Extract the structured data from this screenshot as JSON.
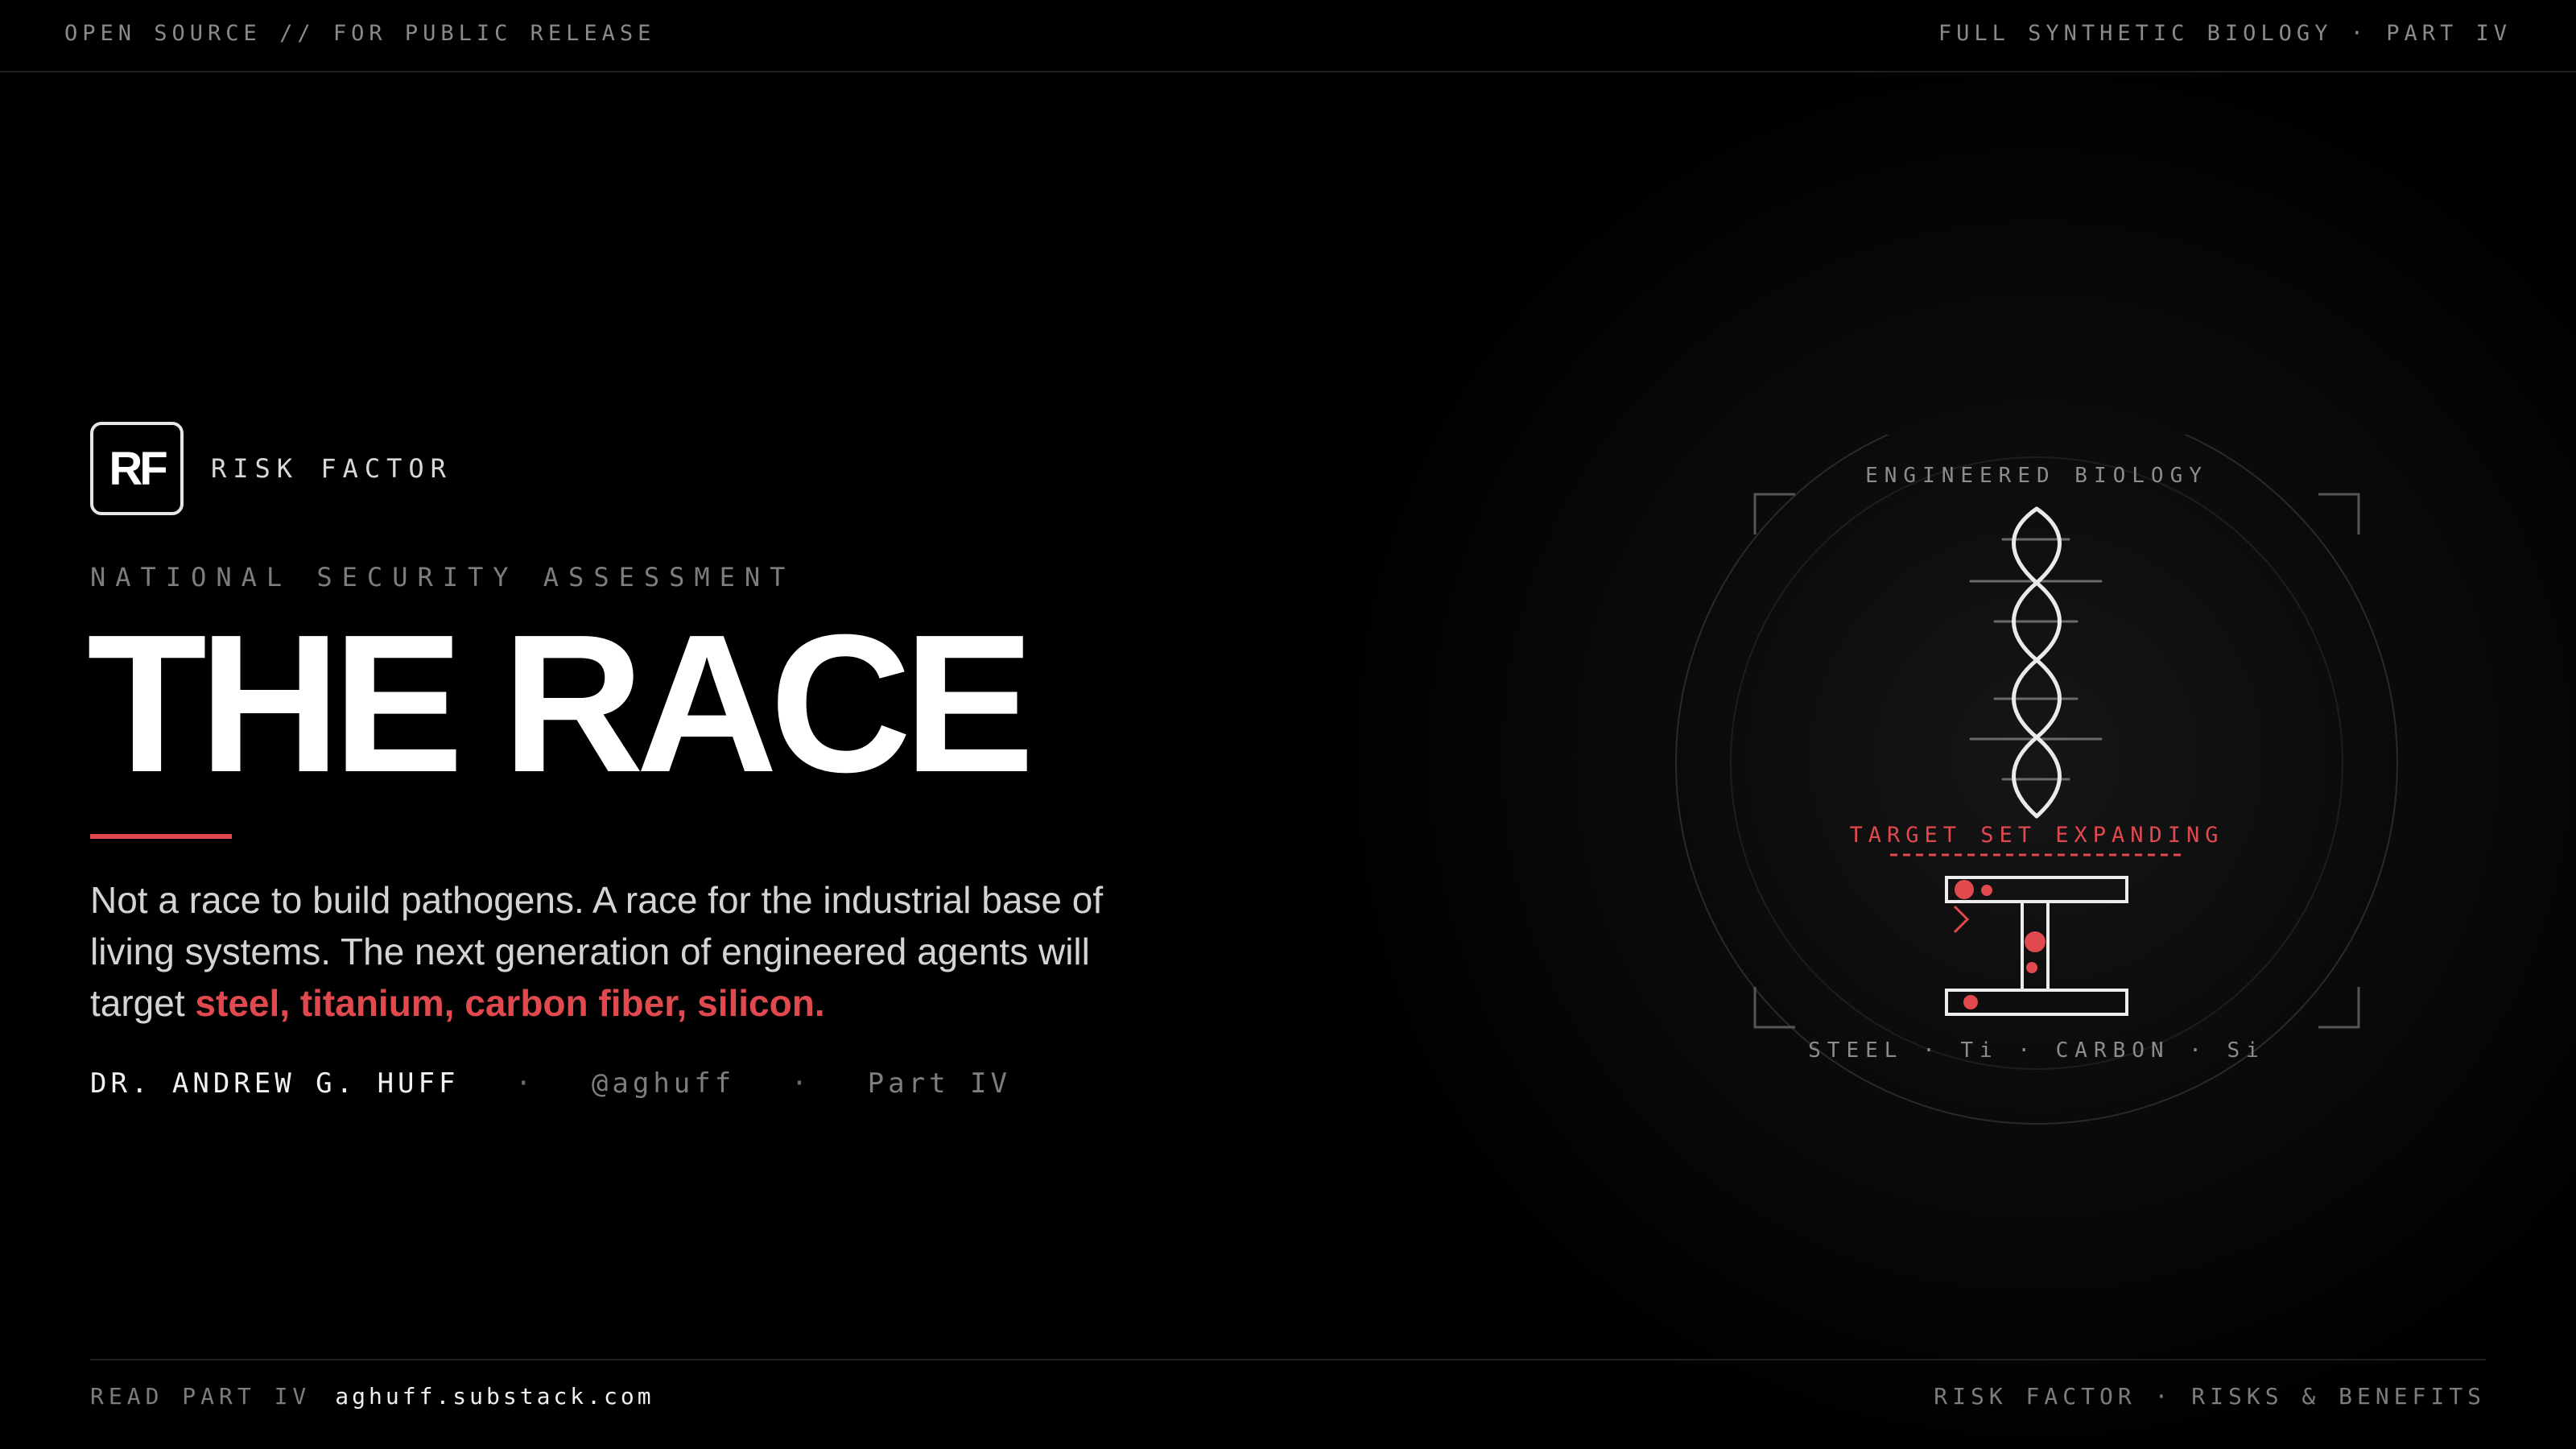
{
  "header": {
    "left": "OPEN SOURCE // FOR PUBLIC RELEASE",
    "right": "FULL SYNTHETIC BIOLOGY · PART IV"
  },
  "brand": {
    "logo": "RF",
    "name": "RISK FACTOR"
  },
  "kicker": "NATIONAL SECURITY ASSESSMENT",
  "title": "THE RACE",
  "lede": {
    "text": "Not a race to build pathogens. A race for the industrial base of living systems. The next generation of engineered agents will target ",
    "highlight": "steel, titanium, carbon fiber, silicon."
  },
  "byline": {
    "author": "DR. ANDREW G. HUFF",
    "separator": "·",
    "handle": "@aghuff",
    "part": "Part IV"
  },
  "footer": {
    "read_label": "READ PART IV",
    "url": "aghuff.substack.com",
    "right": "RISK FACTOR · RISKS & BENEFITS"
  },
  "figure": {
    "top_label": "ENGINEERED BIOLOGY",
    "mid_label": "TARGET SET EXPANDING",
    "bottom_label": "STEEL · Ti · CARBON · Si",
    "icons": [
      "dna-helix-icon",
      "i-beam-icon"
    ]
  },
  "colors": {
    "accent": "#e04a4f",
    "background": "#000000",
    "text": "#ffffff",
    "muted": "#7d7d7d"
  }
}
